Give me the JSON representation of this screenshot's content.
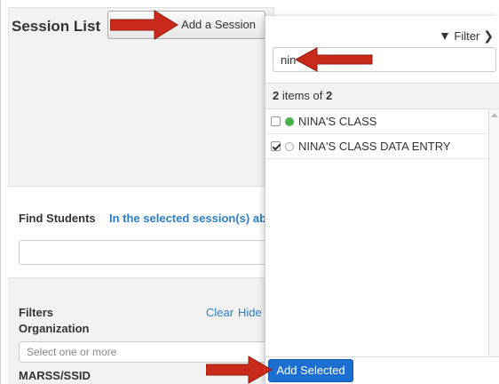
{
  "session_list": {
    "title": "Session List",
    "add_session_label": "Add a Session"
  },
  "find_students": {
    "label": "Find Students",
    "description": "In the selected session(s) ab"
  },
  "filters": {
    "label": "Filters",
    "organization_label": "Organization",
    "clear_label": "Clear",
    "hide_label": "Hide",
    "organization_placeholder": "Select one or more",
    "marss_label": "MARSS/SSID"
  },
  "dropdown": {
    "filter_label": "Filter",
    "search_value": "nin",
    "items_count": "2",
    "items_of_text": "items of",
    "items_total": "2",
    "items": [
      {
        "label": "NINA'S CLASS",
        "checked": false,
        "status": "active"
      },
      {
        "label": "NINA'S CLASS DATA ENTRY",
        "checked": true,
        "status": "inactive"
      }
    ],
    "add_selected_label": "Add Selected"
  },
  "colors": {
    "accent_blue": "#1c6fd1",
    "link_blue": "#2a7dc9",
    "arrow_red": "#c92a1a",
    "status_green": "#46b04b"
  }
}
